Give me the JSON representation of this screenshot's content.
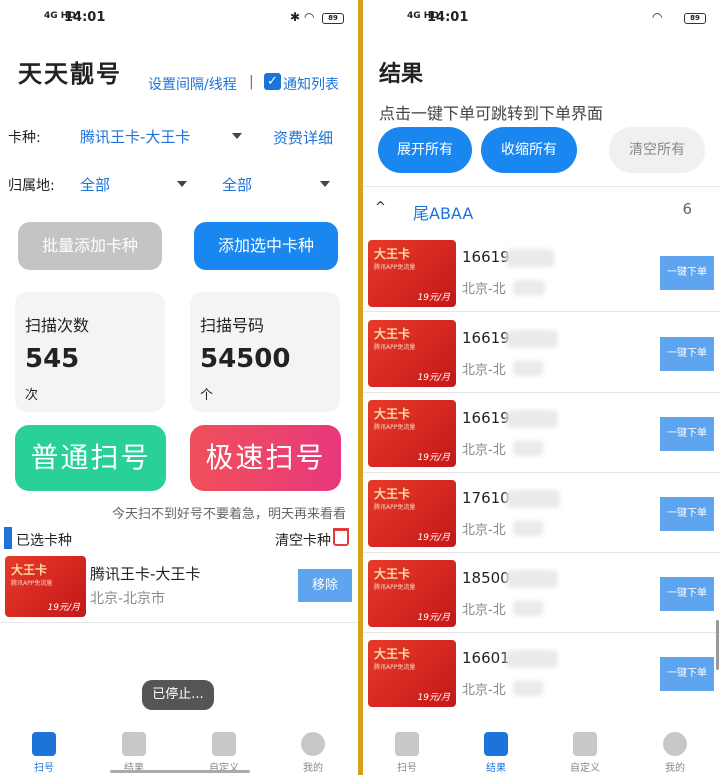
{
  "left": {
    "status": {
      "signal": "4G HD",
      "time": "14:01",
      "battery": "89"
    },
    "title": "天天靓号",
    "interval_link": "设置间隔/线程",
    "separator": "|",
    "notify_checkbox": "✓",
    "notify_label": "通知列表",
    "card_type_label": "卡种:",
    "card_type_value": "腾讯王卡-大王卡",
    "fee_detail": "资费详细",
    "region_label": "归属地:",
    "region_province": "全部",
    "region_city": "全部",
    "batch_add": "批量添加卡种",
    "add_selected": "添加选中卡种",
    "scan_count_title": "扫描次数",
    "scan_count_value": "545",
    "scan_count_unit": "次",
    "scan_numbers_title": "扫描号码",
    "scan_numbers_value": "54500",
    "scan_numbers_unit": "个",
    "normal_scan": "普通扫号",
    "fast_scan": "极速扫号",
    "tip": "今天扫不到好号不要着急，明天再来看看",
    "selected_header": "已选卡种",
    "clear_cards": "清空卡种",
    "selected_card": {
      "image_title": "大王卡",
      "image_sub": "腾讯APP免流量",
      "image_price": "19元/月",
      "name": "腾讯王卡-大王卡",
      "region": "北京-北京市",
      "remove": "移除"
    },
    "toast": "已停止...",
    "tabs": [
      {
        "label": "扫号",
        "active": true
      },
      {
        "label": "结果",
        "active": false
      },
      {
        "label": "自定义",
        "active": false
      },
      {
        "label": "我的",
        "active": false
      }
    ]
  },
  "right": {
    "status": {
      "signal": "4G HD",
      "time": "14:01",
      "battery": "89"
    },
    "title": "结果",
    "subtitle": "点击一键下单可跳转到下单界面",
    "expand_all": "展开所有",
    "collapse_all": "收缩所有",
    "clear_all": "清空所有",
    "group": {
      "chevron": "^",
      "name": "尾ABAA",
      "count": "6"
    },
    "rows": [
      {
        "number": "16619",
        "region": "北京-北",
        "buy": "一键下单"
      },
      {
        "number": "16619",
        "region": "北京-北",
        "buy": "一键下单"
      },
      {
        "number": "16619",
        "region": "北京-北",
        "buy": "一键下单"
      },
      {
        "number": "17610",
        "region": "北京-北",
        "buy": "一键下单"
      },
      {
        "number": "18500",
        "region": "北京-北",
        "buy": "一键下单"
      },
      {
        "number": "16601",
        "region": "北京-北",
        "buy": "一键下单"
      }
    ],
    "card_image": {
      "title": "大王卡",
      "sub": "腾讯APP免流量",
      "price": "19元/月"
    },
    "tabs": [
      {
        "label": "扫号",
        "active": false
      },
      {
        "label": "结果",
        "active": true
      },
      {
        "label": "自定义",
        "active": false
      },
      {
        "label": "我的",
        "active": false
      }
    ]
  },
  "colors": {
    "accent": "#1a86f0",
    "green": "#2ad09a",
    "pink": "#e8387c",
    "divider": "#d6a21e"
  }
}
